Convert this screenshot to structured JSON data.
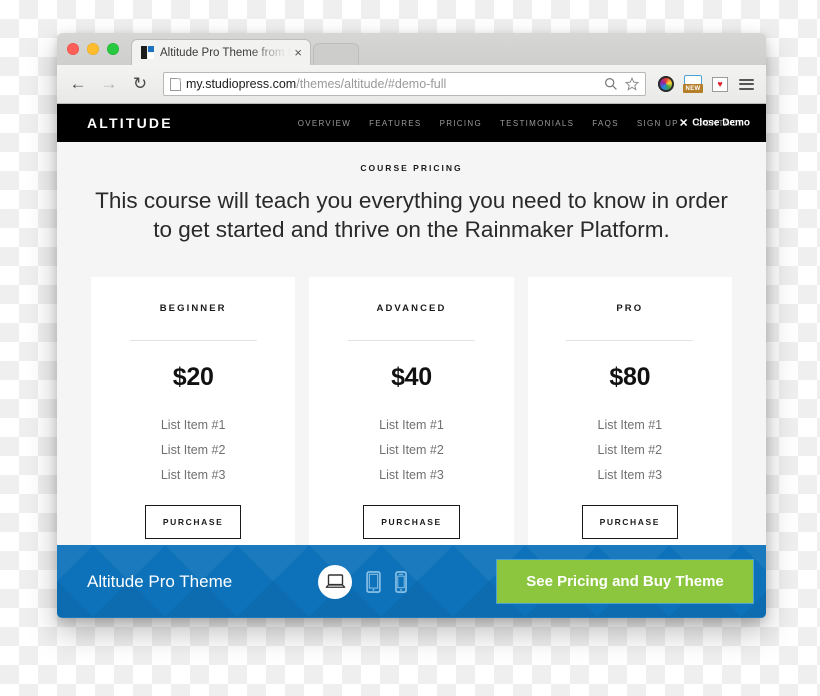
{
  "browser": {
    "tab": {
      "title": "Altitude Pro Theme from S",
      "close_label": "×",
      "favicon": "studiopress-favicon"
    },
    "nav": {
      "back": "←",
      "forward": "→",
      "reload": "↻"
    },
    "url": {
      "host": "my.studiopress.com",
      "path": "/themes/altitude/#demo-full"
    },
    "url_icons": {
      "search": "search-icon",
      "bookmark": "star-icon"
    },
    "extensions": {
      "color_wheel": "color-wheel-extension",
      "new_badge": "NEW",
      "heart": "♥",
      "menu": "hamburger-menu"
    }
  },
  "site": {
    "logo": "ALTITUDE",
    "menu": [
      {
        "label": "OVERVIEW"
      },
      {
        "label": "FEATURES"
      },
      {
        "label": "PRICING"
      },
      {
        "label": "TESTIMONIALS"
      },
      {
        "label": "FAQS"
      },
      {
        "label": "SIGN UP"
      },
      {
        "label": "CONTACT"
      }
    ],
    "close_demo": {
      "icon": "✕",
      "label": "Close Demo"
    }
  },
  "page": {
    "eyebrow": "COURSE PRICING",
    "headline": "This course will teach you everything you need to know in order to get started and thrive on the Rainmaker Platform.",
    "pricing": [
      {
        "title": "BEGINNER",
        "price": "$20",
        "items": [
          "List Item #1",
          "List Item #2",
          "List Item #3"
        ],
        "cta": "PURCHASE"
      },
      {
        "title": "ADVANCED",
        "price": "$40",
        "items": [
          "List Item #1",
          "List Item #2",
          "List Item #3"
        ],
        "cta": "PURCHASE"
      },
      {
        "title": "PRO",
        "price": "$80",
        "items": [
          "List Item #1",
          "List Item #2",
          "List Item #3"
        ],
        "cta": "PURCHASE"
      }
    ]
  },
  "demo_bar": {
    "theme_name": "Altitude Pro Theme",
    "devices": [
      {
        "name": "desktop-view",
        "active": true
      },
      {
        "name": "tablet-view",
        "active": false
      },
      {
        "name": "mobile-view",
        "active": false
      }
    ],
    "cta": "See Pricing and Buy Theme",
    "colors": {
      "bar_blue": "#0d72b9",
      "cta_green": "#8cc63f"
    }
  }
}
